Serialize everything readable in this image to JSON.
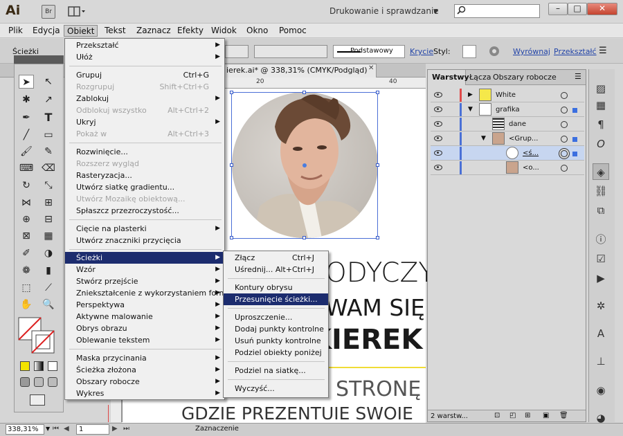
{
  "app": {
    "logo": "Ai",
    "bridge": "Br"
  },
  "workspace": {
    "label": "Drukowanie i sprawdzanie"
  },
  "search": {
    "placeholder": ""
  },
  "window_buttons": {
    "minimize": "–",
    "maximize": "□",
    "close": "✕"
  },
  "menubar": [
    "Plik",
    "Edycja",
    "Obiekt",
    "Tekst",
    "Zaznacz",
    "Efekty",
    "Widok",
    "Okno",
    "Pomoc"
  ],
  "control": {
    "paths_label": "Ścieżki",
    "stroke_profile": "Podstawowy",
    "opacity_label": "Krycie",
    "style_label": "Styl:",
    "align_label": "Wyrównaj",
    "transform_label": "Przekształć"
  },
  "document": {
    "tab_title": "ierek.ai* @ 338,31% (CMYK/Podgląd)",
    "ruler_numbers": [
      "20",
      "40"
    ],
    "zoom": "338,31%",
    "page": "1",
    "status": "Zaznaczenie"
  },
  "canvas_text": {
    "line1": "ODYCZY",
    "line2": "WAM SIĘ",
    "line3": "KIEREK",
    "line4": "A STRONĘ",
    "line5": "GDZIE PREZENTUIE SWOIE"
  },
  "object_menu": {
    "items": [
      {
        "label": "Przekształć",
        "shortcut": "",
        "sub": true,
        "disabled": false
      },
      {
        "label": "Ułóż",
        "shortcut": "",
        "sub": true,
        "disabled": false
      },
      {
        "label": "Grupuj",
        "shortcut": "Ctrl+G",
        "sub": false,
        "disabled": false
      },
      {
        "label": "Rozgrupuj",
        "shortcut": "Shift+Ctrl+G",
        "sub": false,
        "disabled": true
      },
      {
        "label": "Zablokuj",
        "shortcut": "",
        "sub": true,
        "disabled": false
      },
      {
        "label": "Odblokuj wszystko",
        "shortcut": "Alt+Ctrl+2",
        "sub": false,
        "disabled": true
      },
      {
        "label": "Ukryj",
        "shortcut": "",
        "sub": true,
        "disabled": false
      },
      {
        "label": "Pokaż w",
        "shortcut": "Alt+Ctrl+3",
        "sub": false,
        "disabled": true
      },
      {
        "label": "Rozwinięcie...",
        "shortcut": "",
        "sub": false,
        "disabled": false
      },
      {
        "label": "Rozszerz wygląd",
        "shortcut": "",
        "sub": false,
        "disabled": true
      },
      {
        "label": "Rasteryzacja...",
        "shortcut": "",
        "sub": false,
        "disabled": false
      },
      {
        "label": "Utwórz siatkę gradientu...",
        "shortcut": "",
        "sub": false,
        "disabled": false
      },
      {
        "label": "Utwórz Mozaikę obiektową...",
        "shortcut": "",
        "sub": false,
        "disabled": true
      },
      {
        "label": "Spłaszcz przezroczystość...",
        "shortcut": "",
        "sub": false,
        "disabled": false
      },
      {
        "label": "Cięcie na plasterki",
        "shortcut": "",
        "sub": true,
        "disabled": false
      },
      {
        "label": "Utwórz znaczniki przycięcia",
        "shortcut": "",
        "sub": false,
        "disabled": false
      },
      {
        "label": "Ścieżki",
        "shortcut": "",
        "sub": true,
        "disabled": false
      },
      {
        "label": "Wzór",
        "shortcut": "",
        "sub": true,
        "disabled": false
      },
      {
        "label": "Stwórz przejście",
        "shortcut": "",
        "sub": true,
        "disabled": false
      },
      {
        "label": "Zniekształcenie z wykorzystaniem formy",
        "shortcut": "",
        "sub": true,
        "disabled": false
      },
      {
        "label": "Perspektywa",
        "shortcut": "",
        "sub": true,
        "disabled": false
      },
      {
        "label": "Aktywne malowanie",
        "shortcut": "",
        "sub": true,
        "disabled": false
      },
      {
        "label": "Obrys obrazu",
        "shortcut": "",
        "sub": true,
        "disabled": false
      },
      {
        "label": "Oblewanie tekstem",
        "shortcut": "",
        "sub": true,
        "disabled": false
      },
      {
        "label": "Maska przycinania",
        "shortcut": "",
        "sub": true,
        "disabled": false
      },
      {
        "label": "Ścieżka złożona",
        "shortcut": "",
        "sub": true,
        "disabled": false
      },
      {
        "label": "Obszary robocze",
        "shortcut": "",
        "sub": true,
        "disabled": false
      },
      {
        "label": "Wykres",
        "shortcut": "",
        "sub": true,
        "disabled": false
      }
    ]
  },
  "paths_submenu": {
    "items": [
      {
        "label": "Złącz",
        "shortcut": "Ctrl+J"
      },
      {
        "label": "Uśrednij...",
        "shortcut": "Alt+Ctrl+J"
      },
      {
        "label": "Kontury obrysu",
        "shortcut": ""
      },
      {
        "label": "Przesunięcie ścieżki...",
        "shortcut": ""
      },
      {
        "label": "Uproszczenie...",
        "shortcut": ""
      },
      {
        "label": "Dodaj punkty kontrolne",
        "shortcut": ""
      },
      {
        "label": "Usuń punkty kontrolne",
        "shortcut": ""
      },
      {
        "label": "Podziel obiekty poniżej",
        "shortcut": ""
      },
      {
        "label": "Podziel na siatkę...",
        "shortcut": ""
      },
      {
        "label": "Wyczyść...",
        "shortcut": ""
      }
    ]
  },
  "layers": {
    "tabs": [
      "Warstwy",
      "Łącza",
      "Obszary robocze"
    ],
    "rows": [
      {
        "name": "White",
        "color": "#e04a4a"
      },
      {
        "name": "grafika",
        "color": "#4a70d6"
      },
      {
        "name": "dane",
        "color": "#4a70d6"
      },
      {
        "name": "<Grup...",
        "color": "#4a70d6"
      },
      {
        "name": "<ś...",
        "color": "#4a70d6"
      },
      {
        "name": "<o...",
        "color": "#4a70d6"
      }
    ],
    "count": "2 warstw..."
  }
}
